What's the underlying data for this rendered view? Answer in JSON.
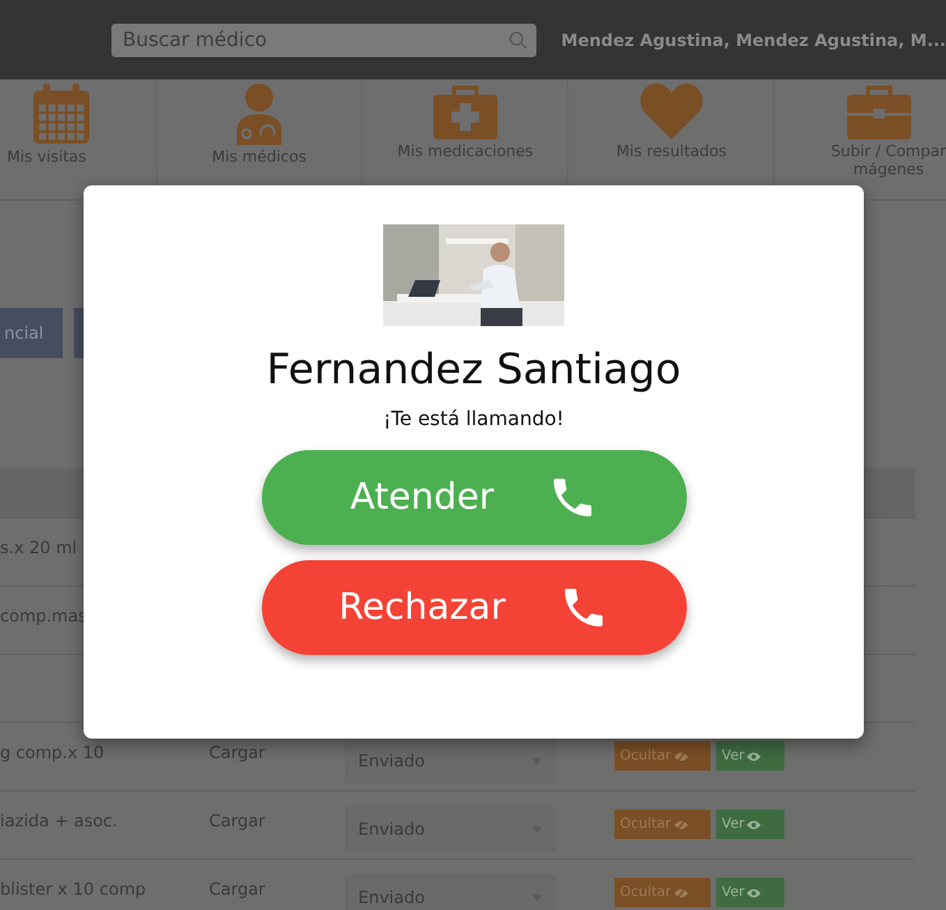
{
  "header": {
    "search": {
      "placeholder": "Buscar médico"
    },
    "user": "Mendez Agustina, Mendez Agustina, M..."
  },
  "nav": [
    {
      "lines": [
        "Mis visitas"
      ]
    },
    {
      "lines": [
        "Mis médicos"
      ]
    },
    {
      "lines": [
        "Mis medicaciones"
      ]
    },
    {
      "lines": [
        "Mis resultados"
      ]
    },
    {
      "lines": [
        "Subir / Compar",
        "mágenes"
      ]
    }
  ],
  "toolbar": {
    "button": "ncial"
  },
  "table": {
    "rows": [
      {
        "name": "s.x 20 ml"
      },
      {
        "name": "comp.mas"
      },
      {},
      {
        "name": "g comp.x 10",
        "load": "Cargar",
        "status": "Enviado",
        "hide": "Ocultar",
        "view": "Ver"
      },
      {
        "name": "iazida + asoc.",
        "load": "Cargar",
        "status": "Enviado",
        "hide": "Ocultar",
        "view": "Ver"
      },
      {
        "name": "blister x 10 comp",
        "load": "Cargar",
        "status": "Enviado",
        "hide": "Ocultar",
        "view": "Ver"
      }
    ]
  },
  "call": {
    "caller": "Fernandez Santiago",
    "message": "¡Te está llamando!",
    "buttons": [
      {
        "kind": "accept",
        "label": "Atender"
      },
      {
        "kind": "reject",
        "label": "Rechazar"
      }
    ]
  }
}
